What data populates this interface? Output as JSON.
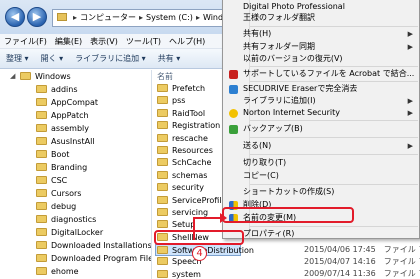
{
  "address": {
    "segments": [
      "コンピューター",
      "System (C:)",
      "Windows"
    ]
  },
  "menubar": [
    "ファイル(F)",
    "編集(E)",
    "表示(V)",
    "ツール(T)",
    "ヘルプ(H)"
  ],
  "toolbar": [
    "整理 ▾",
    "開く ▾",
    "ライブラリに追加 ▾",
    "共有 ▾"
  ],
  "tree": {
    "root": "Windows",
    "items": [
      "addins",
      "AppCompat",
      "AppPatch",
      "assembly",
      "AsusInstAll",
      "Boot",
      "Branding",
      "CSC",
      "Cursors",
      "debug",
      "diagnostics",
      "DigitalLocker",
      "Downloaded Installations",
      "Downloaded Program Files",
      "ehome"
    ]
  },
  "content": {
    "column_header": "名前",
    "files": [
      "Prefetch",
      "pss",
      "RaidTool",
      "Registration",
      "rescache",
      "Resources",
      "SchCache",
      "schemas",
      "security",
      "ServiceProfiles",
      "servicing",
      "Setup",
      "ShellNew",
      "SoftwareDistribution",
      "Speech",
      "system"
    ],
    "selected": "SoftwareDistribution",
    "date_rows": [
      {
        "date": "2015/04/06 17:45",
        "type": "ファイル フォ"
      },
      {
        "date": "2015/04/07 14:16",
        "type": "ファイル フォ"
      },
      {
        "date": "2009/07/14 11:36",
        "type": "ファイル フォ"
      }
    ]
  },
  "context_menu": {
    "items": [
      {
        "label": "Digital Photo Professional"
      },
      {
        "label": "王様のフォルダ翻訳"
      },
      {
        "label": "共有(H)",
        "submenu": true
      },
      {
        "label": "共有フォルダー同期",
        "submenu": true
      },
      {
        "label": "以前のバージョンの復元(V)"
      },
      {
        "label": "サポートしているファイルを Acrobat で結合...",
        "icon": "acrobat"
      },
      {
        "label": "SECUDRIVE Eraserで完全消去",
        "icon": "eraser"
      },
      {
        "label": "ライブラリに追加(I)",
        "submenu": true
      },
      {
        "label": "Norton Internet Security",
        "submenu": true,
        "icon": "norton"
      },
      {
        "label": "バックアップ(B)",
        "icon": "backup"
      },
      {
        "label": "送る(N)",
        "submenu": true
      },
      {
        "label": "切り取り(T)"
      },
      {
        "label": "コピー(C)"
      },
      {
        "label": "ショートカットの作成(S)"
      },
      {
        "label": "削除(D)",
        "icon": "shield"
      },
      {
        "label": "名前の変更(M)",
        "icon": "shield"
      },
      {
        "label": "プロパティ(R)"
      }
    ]
  },
  "annotation": {
    "step_number": "4",
    "color": "#e21b2a"
  }
}
